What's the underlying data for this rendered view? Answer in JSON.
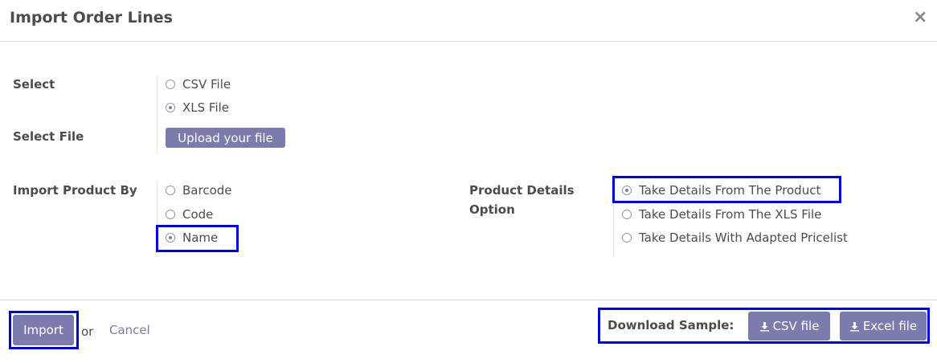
{
  "dialog": {
    "title": "Import Order Lines",
    "close_symbol": "×"
  },
  "select": {
    "label": "Select",
    "options": [
      {
        "label": "CSV File",
        "checked": false
      },
      {
        "label": "XLS File",
        "checked": true
      }
    ]
  },
  "select_file": {
    "label": "Select File",
    "button_label": "Upload your file"
  },
  "import_product_by": {
    "label": "Import Product By",
    "options": [
      {
        "label": "Barcode",
        "checked": false
      },
      {
        "label": "Code",
        "checked": false
      },
      {
        "label": "Name",
        "checked": true
      }
    ]
  },
  "product_details": {
    "label_line1": "Product Details",
    "label_line2": "Option",
    "options": [
      {
        "label": "Take Details From The Product",
        "checked": true
      },
      {
        "label": "Take Details From The XLS File",
        "checked": false
      },
      {
        "label": "Take Details With Adapted Pricelist",
        "checked": false
      }
    ]
  },
  "footer": {
    "import_label": "Import",
    "or_text": "or",
    "cancel_label": "Cancel",
    "download_label": "Download Sample:",
    "csv_button": "CSV file",
    "excel_button": "Excel file"
  },
  "colors": {
    "primary": "#7c7bad",
    "highlight": "#0000d6"
  }
}
